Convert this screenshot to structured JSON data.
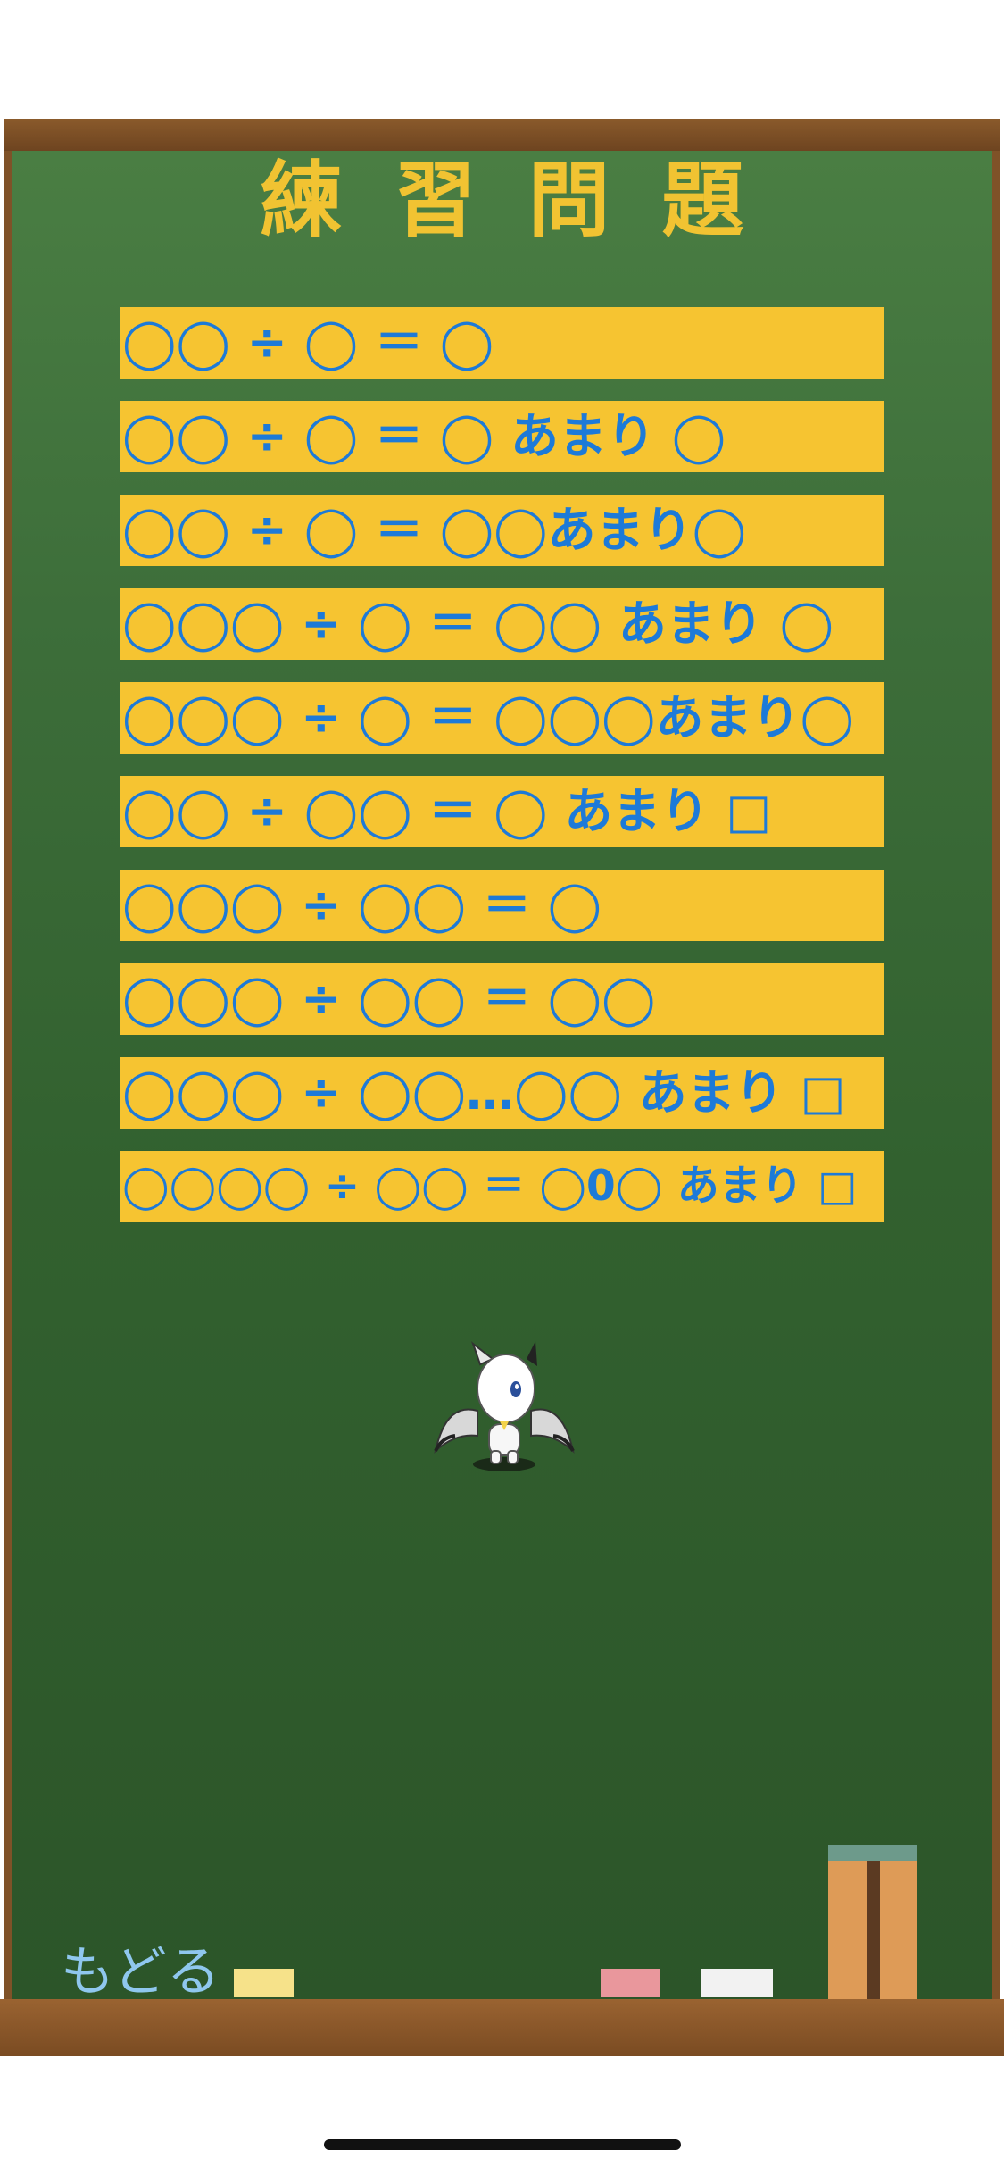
{
  "title": "練習問題",
  "problems": [
    "◯◯ ÷ ◯ ＝ ◯",
    "◯◯ ÷ ◯ ＝ ◯ あまり ◯",
    "◯◯ ÷ ◯ ＝ ◯◯あまり◯",
    "◯◯◯ ÷ ◯ ＝ ◯◯ あまり ◯",
    "◯◯◯ ÷ ◯ ＝ ◯◯◯あまり◯",
    "◯◯ ÷ ◯◯ ＝ ◯ あまり □",
    "◯◯◯ ÷ ◯◯ ＝ ◯",
    "◯◯◯ ÷ ◯◯ ＝ ◯◯",
    "◯◯◯ ÷ ◯◯…◯◯ あまり □",
    "◯◯◯◯ ÷ ◯◯ ＝ ◯0◯ あまり □"
  ],
  "back_label": "もどる",
  "colors": {
    "board": "#3d6e3a",
    "frame": "#7f5228",
    "title": "#f1c332",
    "item_background": "#f6c431",
    "item_text": "#1d7ad8",
    "back_text": "#8fc7ee"
  },
  "icons": {
    "mascot": "white-bat-mascot",
    "chalk": [
      "yellow-chalk",
      "pink-chalk",
      "white-chalk"
    ],
    "books": "books-icon"
  }
}
